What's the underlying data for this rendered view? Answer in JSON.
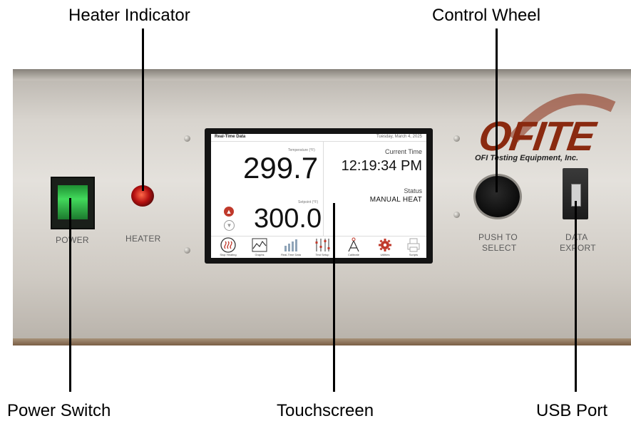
{
  "callouts": {
    "heater_indicator": "Heater Indicator",
    "control_wheel": "Control Wheel",
    "power_switch": "Power Switch",
    "touchscreen": "Touchscreen",
    "usb_port": "USB Port"
  },
  "panel_labels": {
    "power": "POWER",
    "heater": "HEATER",
    "push_line1": "PUSH TO",
    "push_line2": "SELECT",
    "data_line1": "DATA",
    "data_line2": "EXPORT"
  },
  "logo": {
    "name": "OFITE",
    "tagline": "OFI Testing Equipment, Inc."
  },
  "screen": {
    "title": "Real-Time Data",
    "date": "Tuesday, March 4, 2025",
    "temperature_label": "Temperature (°F)",
    "temperature_value": "299.7",
    "setpoint_label": "Setpoint (°F)",
    "setpoint_value": "300.0",
    "current_time_label": "Current Time",
    "current_time": "12:19:34 PM",
    "status_label": "Status",
    "status_value": "MANUAL HEAT",
    "toolbar": [
      {
        "label": "Stop Heating",
        "icon": "heat-waves-icon"
      },
      {
        "label": "Graphs",
        "icon": "line-graph-icon"
      },
      {
        "label": "Real-Time Data",
        "icon": "bar-chart-icon"
      },
      {
        "label": "Test Setup",
        "icon": "sliders-icon"
      },
      {
        "label": "Calibrate",
        "icon": "compass-icon"
      },
      {
        "label": "Utilities",
        "icon": "gear-icon"
      },
      {
        "label": "Scripts",
        "icon": "printer-icon"
      }
    ]
  },
  "colors": {
    "accent_red": "#c0392b",
    "logo_red": "#8a2a10",
    "power_green": "#42d95b"
  }
}
